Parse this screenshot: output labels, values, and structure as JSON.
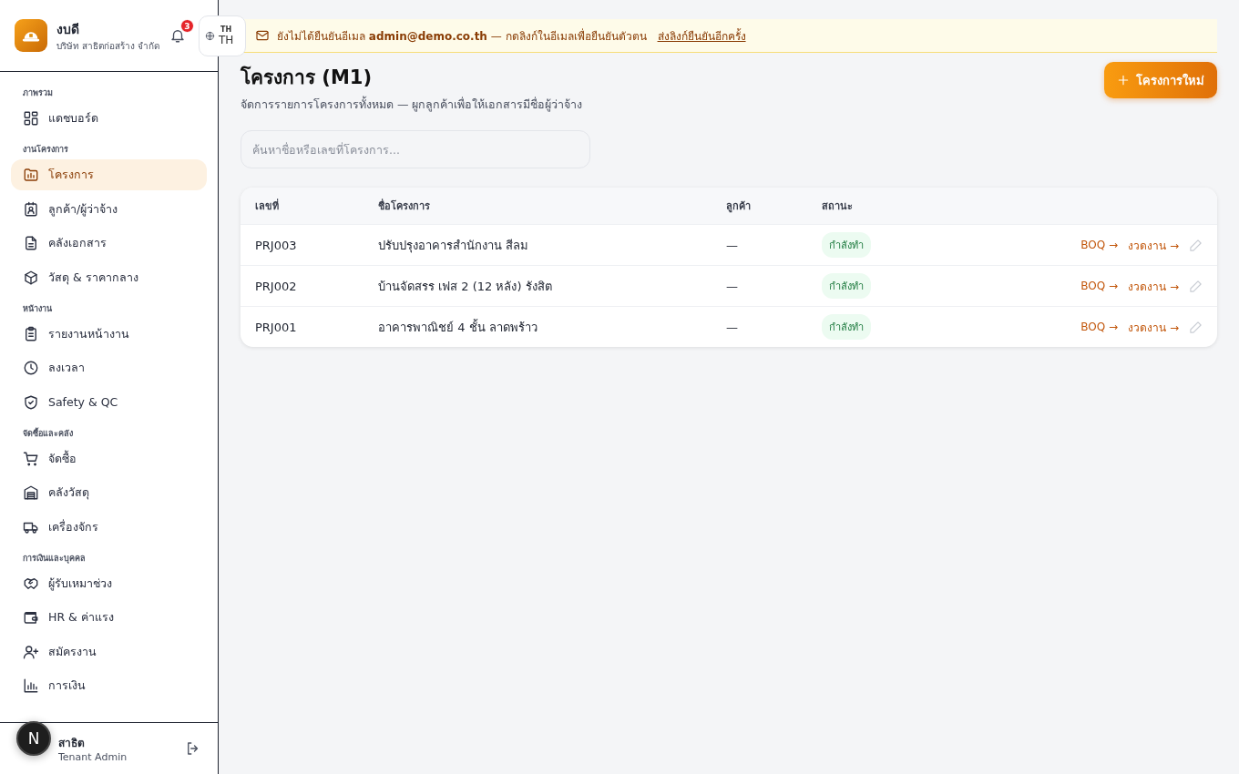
{
  "brand": {
    "name": "งบดี",
    "company": "บริษัท สาธิตก่อสร้าง จำกัด"
  },
  "notifications": {
    "count": "3"
  },
  "language": {
    "code_small": "TH",
    "code": "TH"
  },
  "sidebar": {
    "sections": [
      {
        "title": "ภาพรวม",
        "items": [
          {
            "label": "แดชบอร์ด",
            "selected": false
          }
        ]
      },
      {
        "title": "งานโครงการ",
        "items": [
          {
            "label": "โครงการ",
            "selected": true
          },
          {
            "label": "ลูกค้า/ผู้ว่าจ้าง",
            "selected": false
          },
          {
            "label": "คลังเอกสาร",
            "selected": false
          },
          {
            "label": "วัสดุ & ราคากลาง",
            "selected": false
          }
        ]
      },
      {
        "title": "หน้างาน",
        "items": [
          {
            "label": "รายงานหน้างาน",
            "selected": false
          },
          {
            "label": "ลงเวลา",
            "selected": false
          },
          {
            "label": "Safety & QC",
            "selected": false
          }
        ]
      },
      {
        "title": "จัดซื้อและคลัง",
        "items": [
          {
            "label": "จัดซื้อ",
            "selected": false
          },
          {
            "label": "คลังวัสดุ",
            "selected": false
          },
          {
            "label": "เครื่องจักร",
            "selected": false
          }
        ]
      },
      {
        "title": "การเงินและบุคคล",
        "items": [
          {
            "label": "ผู้รับเหมาช่วง",
            "selected": false
          },
          {
            "label": "HR & ค่าแรง",
            "selected": false
          },
          {
            "label": "สมัครงาน",
            "selected": false
          },
          {
            "label": "การเงิน",
            "selected": false
          }
        ]
      }
    ],
    "user": {
      "name": "สาธิต",
      "role": "Tenant Admin"
    },
    "dev_badge": "N"
  },
  "banner": {
    "message": "ยังไม่ได้ยืนยันอีเมล **admin@demo.co.th** — กดลิงก์ในอีเมลเพื่อยืนยันตัวตน",
    "link": "ส่งลิงก์ยืนยันอีกครั้ง"
  },
  "page": {
    "title": "โครงการ (M1)",
    "subtitle": "จัดการรายการโครงการทั้งหมด — ผูกลูกค้าเพื่อให้เอกสารมีชื่อผู้ว่าจ้าง",
    "new_button": "โครงการใหม่"
  },
  "search": {
    "placeholder": "ค้นหาชื่อหรือเลขที่โครงการ..."
  },
  "table": {
    "columns": [
      "เลขที่",
      "ชื่อโครงการ",
      "ลูกค้า",
      "สถานะ"
    ],
    "rows": [
      {
        "number": "PRJ003",
        "name": "ปรับปรุงอาคารสำนักงาน สีลม",
        "customer": "—",
        "status": "กำลังทำ",
        "actions": [
          "BOQ →",
          "งวดงาน →"
        ]
      },
      {
        "number": "PRJ002",
        "name": "บ้านจัดสรร เฟส 2 (12 หลัง) รังสิต",
        "customer": "—",
        "status": "กำลังทำ",
        "actions": [
          "BOQ →",
          "งวดงาน →"
        ]
      },
      {
        "number": "PRJ001",
        "name": "อาคารพาณิชย์ 4 ชั้น ลาดพร้าว",
        "customer": "—",
        "status": "กำลังทำ",
        "actions": [
          "BOQ →",
          "งวดงาน →"
        ]
      }
    ]
  }
}
